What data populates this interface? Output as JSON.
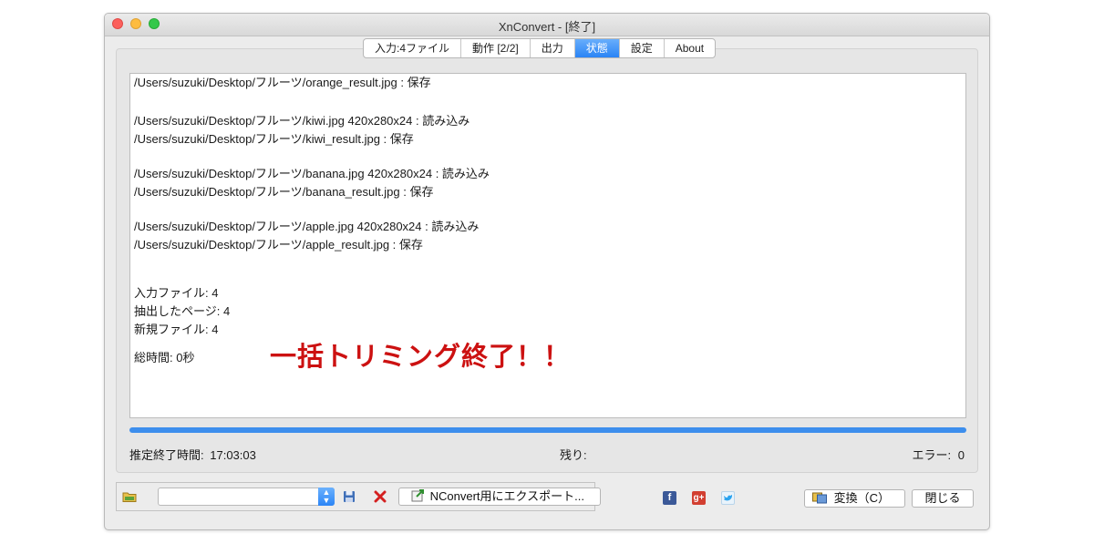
{
  "window": {
    "title": "XnConvert - [終了]"
  },
  "tabs": [
    {
      "label": "入力:4ファイル",
      "active": false
    },
    {
      "label": "動作 [2/2]",
      "active": false
    },
    {
      "label": "出力",
      "active": false
    },
    {
      "label": "状態",
      "active": true
    },
    {
      "label": "設定",
      "active": false
    },
    {
      "label": "About",
      "active": false
    }
  ],
  "log": {
    "lines": [
      "/Users/suzuki/Desktop/フルーツ/orange_result.jpg : 保存",
      "/Users/suzuki/Desktop/フルーツ/kiwi.jpg 420x280x24 : 読み込み",
      "/Users/suzuki/Desktop/フルーツ/kiwi_result.jpg : 保存",
      "/Users/suzuki/Desktop/フルーツ/banana.jpg 420x280x24 : 読み込み",
      "/Users/suzuki/Desktop/フルーツ/banana_result.jpg : 保存",
      "/Users/suzuki/Desktop/フルーツ/apple.jpg 420x280x24 : 読み込み",
      "/Users/suzuki/Desktop/フルーツ/apple_result.jpg : 保存"
    ],
    "summary": [
      "入力ファイル: 4",
      "抽出したページ: 4",
      "新規ファイル: 4",
      "総時間: 0秒"
    ]
  },
  "annotation": {
    "text": "一括トリミング終了！！",
    "color": "#cc1111"
  },
  "progress": {
    "fraction": 1.0,
    "color": "#3d8eed"
  },
  "status": {
    "estimated_end_label": "推定終了時間:",
    "estimated_end_value": "17:03:03",
    "remaining_label": "残り:",
    "remaining_value": "",
    "errors_label": "エラー:",
    "errors_value": "0"
  },
  "toolbar": {
    "preset_value": "",
    "export_label": "NConvert用にエクスポート...",
    "convert_label": "変換（C）",
    "close_label": "閉じる"
  },
  "icons": {
    "folder": "folder-icon",
    "save": "floppy-disk-icon",
    "delete": "red-x-icon",
    "export": "export-icon",
    "convert": "convert-icon",
    "facebook": "facebook-icon",
    "google_plus": "google-plus-icon",
    "twitter": "twitter-icon"
  }
}
